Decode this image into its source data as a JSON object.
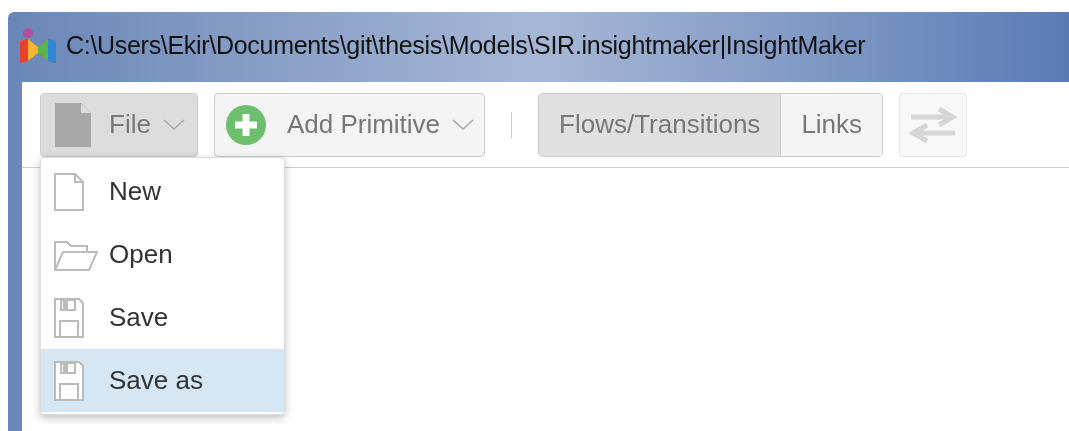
{
  "window": {
    "title": "C:\\Users\\Ekir\\Documents\\git\\thesis\\Models\\SIR.insightmaker|InsightMaker"
  },
  "toolbar": {
    "file_button": {
      "label": "File",
      "expanded": true
    },
    "add_primitive_button": {
      "label": "Add Primitive"
    },
    "connection_toggle": [
      {
        "label": "Flows/Transitions",
        "selected": true
      },
      {
        "label": "Links",
        "selected": false
      }
    ],
    "swap_button": {
      "disabled": true
    }
  },
  "file_menu": [
    {
      "label": "New",
      "selected": false
    },
    {
      "label": "Open",
      "selected": false
    },
    {
      "label": "Save",
      "selected": false
    },
    {
      "label": "Save as",
      "selected": true
    }
  ]
}
